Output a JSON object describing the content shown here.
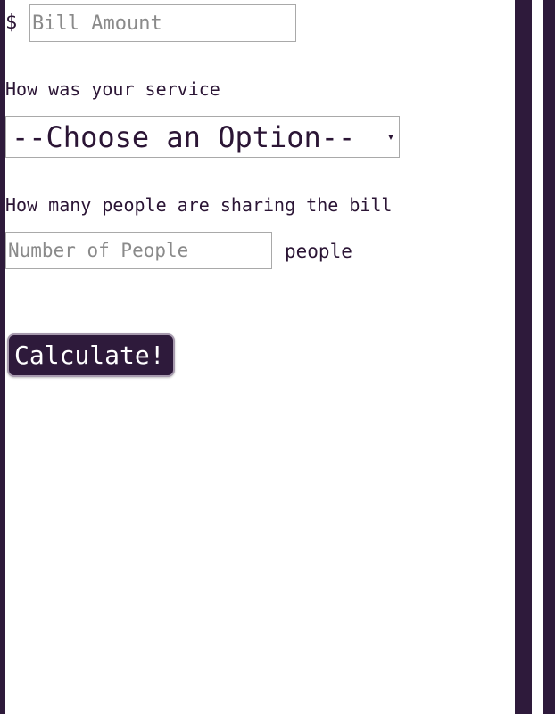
{
  "bill": {
    "currency_symbol": "$",
    "placeholder": "Bill Amount",
    "value": ""
  },
  "service": {
    "label": "How was your service",
    "selected_option": "--Choose an Option--"
  },
  "people": {
    "label": "How many people are sharing the bill",
    "placeholder": "Number of People",
    "value": "",
    "suffix": "people"
  },
  "actions": {
    "calculate_label": "Calculate!"
  },
  "colors": {
    "accent": "#2e1a3b",
    "text": "#2b1535",
    "background": "#ffffff",
    "border": "#a9a9a9"
  },
  "icons": {
    "select_caret": "chevron-down-icon"
  }
}
